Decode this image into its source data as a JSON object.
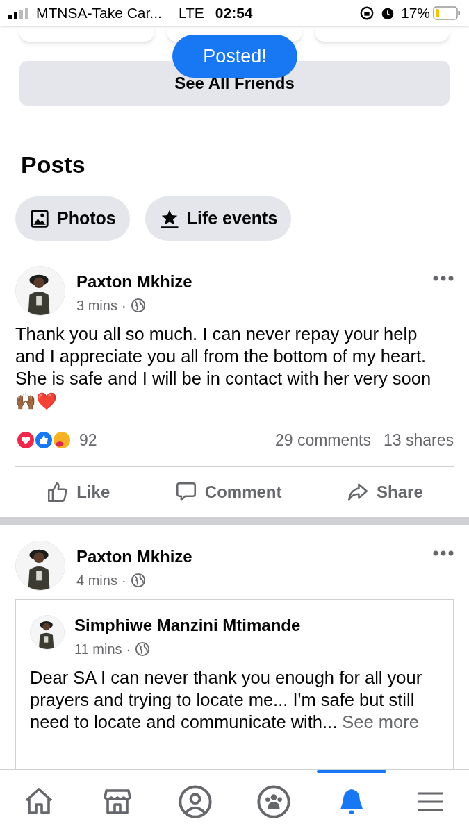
{
  "status_bar": {
    "carrier": "MTNSA-Take Car...",
    "network": "LTE",
    "time": "02:54",
    "battery": "17%"
  },
  "toast": {
    "text": "Posted!"
  },
  "see_all_button": {
    "label": "See All Friends"
  },
  "section": {
    "title": "Posts"
  },
  "chips": [
    {
      "kind": "photos",
      "label": "Photos"
    },
    {
      "kind": "life_events",
      "label": "Life events"
    }
  ],
  "posts": [
    {
      "author": "Paxton Mkhize",
      "time": "3 mins",
      "separator": "·",
      "text": "Thank you all so much. I can never repay your help and I appreciate you all from the bottom of my heart. She is safe and I will be in contact with her very soon",
      "emoji": "🙌🏾❤️",
      "reaction_count": "92",
      "comments": "29 comments",
      "shares": "13 shares",
      "actions": [
        {
          "kind": "like",
          "label": "Like"
        },
        {
          "kind": "comment",
          "label": "Comment"
        },
        {
          "kind": "share",
          "label": "Share"
        }
      ]
    },
    {
      "author": "Paxton Mkhize",
      "time": "4 mins",
      "separator": "·",
      "shared": {
        "author": "Simphiwe Manzini Mtimande",
        "time": "11 mins",
        "separator": "·",
        "text": "Dear SA I can never thank you enough for all your prayers and trying to locate me... I'm safe but still need to locate and communicate with...",
        "see_more": "See more"
      }
    }
  ],
  "bottom_nav": [
    {
      "kind": "home",
      "selected": false
    },
    {
      "kind": "store",
      "selected": false
    },
    {
      "kind": "profile",
      "selected": false
    },
    {
      "kind": "groups",
      "selected": false
    },
    {
      "kind": "bell",
      "selected": true
    },
    {
      "kind": "menu",
      "selected": false
    }
  ]
}
